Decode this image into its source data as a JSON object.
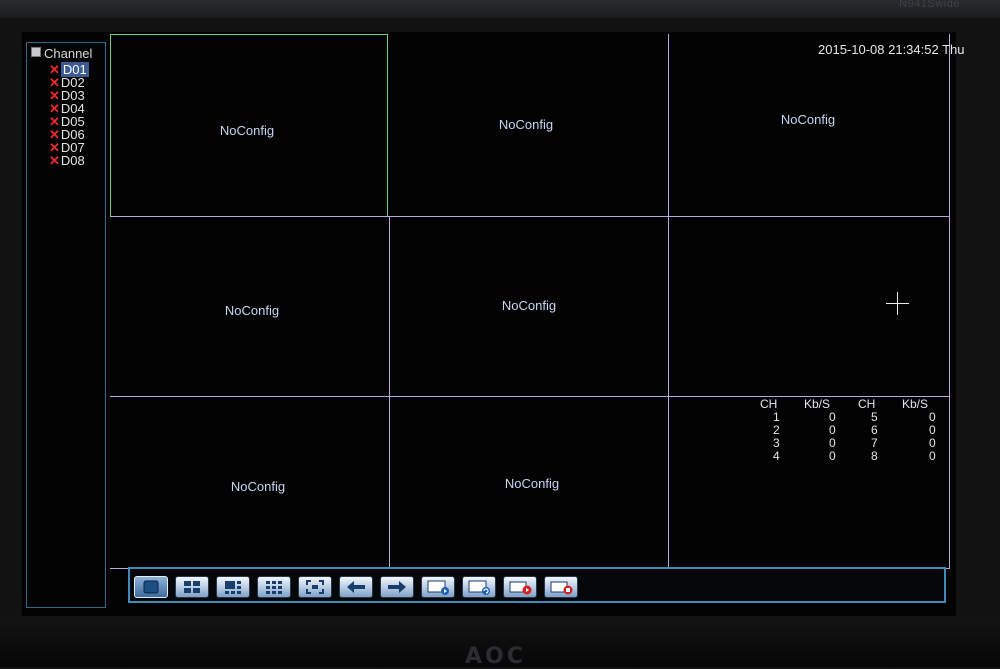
{
  "monitor": {
    "model_label": "N941Swide",
    "logo": "AOC"
  },
  "sidebar": {
    "root_label": "Channel",
    "channels": [
      {
        "label": "D01",
        "selected": true
      },
      {
        "label": "D02",
        "selected": false
      },
      {
        "label": "D03",
        "selected": false
      },
      {
        "label": "D04",
        "selected": false
      },
      {
        "label": "D05",
        "selected": false
      },
      {
        "label": "D06",
        "selected": false
      },
      {
        "label": "D07",
        "selected": false
      },
      {
        "label": "D08",
        "selected": false
      }
    ]
  },
  "overlay": {
    "datetime": "2015-10-08 21:34:52 Thu"
  },
  "grid": {
    "cells": [
      {
        "label": "NoConfig"
      },
      {
        "label": "NoConfig"
      },
      {
        "label": "NoConfig"
      },
      {
        "label": "NoConfig"
      },
      {
        "label": "NoConfig"
      },
      {
        "label": ""
      },
      {
        "label": "NoConfig"
      },
      {
        "label": "NoConfig"
      },
      {
        "label": ""
      }
    ]
  },
  "bitrate": {
    "headers": [
      "CH",
      "Kb/S",
      "CH",
      "Kb/S"
    ],
    "rows": [
      [
        "1",
        "0",
        "5",
        "0"
      ],
      [
        "2",
        "0",
        "6",
        "0"
      ],
      [
        "3",
        "0",
        "7",
        "0"
      ],
      [
        "4",
        "0",
        "8",
        "0"
      ]
    ]
  },
  "toolbar": {
    "buttons": [
      {
        "name": "single-view-icon",
        "selected": true
      },
      {
        "name": "quad-view-icon",
        "selected": false
      },
      {
        "name": "six-view-icon",
        "selected": false
      },
      {
        "name": "nine-view-icon",
        "selected": false
      },
      {
        "name": "fullscreen-icon",
        "selected": false
      },
      {
        "name": "previous-arrow-icon",
        "selected": false
      },
      {
        "name": "next-arrow-icon",
        "selected": false
      },
      {
        "name": "playback-icon",
        "selected": false
      },
      {
        "name": "tour-icon",
        "selected": false
      },
      {
        "name": "record-start-icon",
        "selected": false
      },
      {
        "name": "record-stop-icon",
        "selected": false
      }
    ]
  },
  "colors": {
    "active_cell_border": "#6fd27a",
    "grid_lines": "#b9a7e0",
    "toolbar_border": "#3c8bb8",
    "channel_error": "#ee2a2a"
  }
}
